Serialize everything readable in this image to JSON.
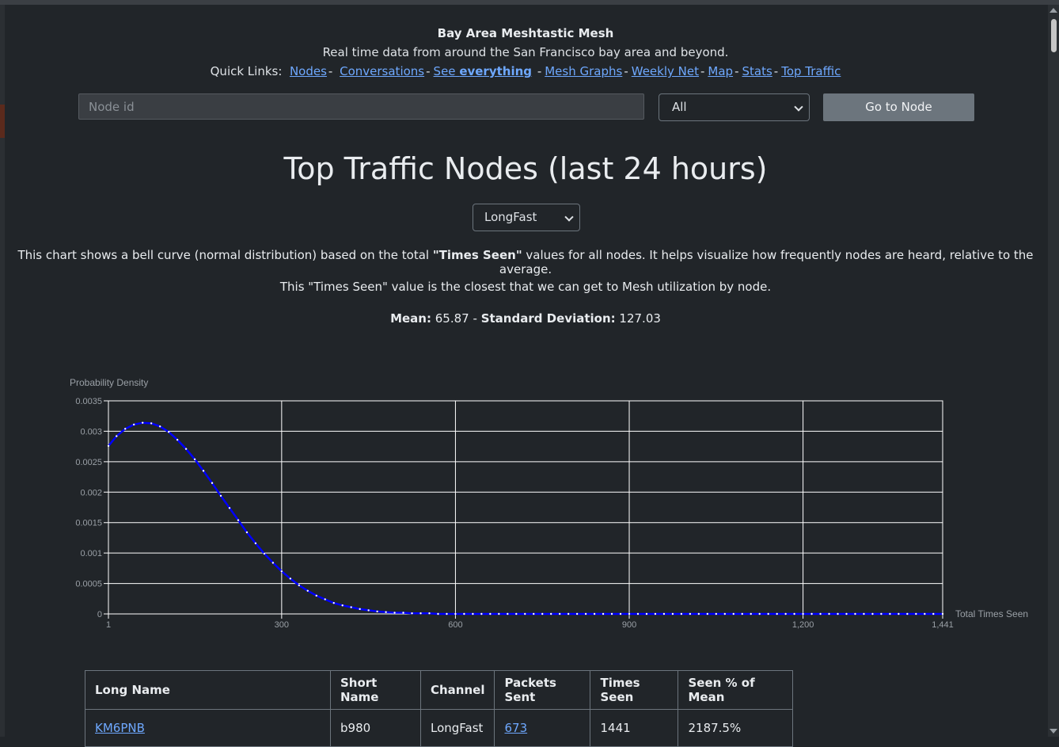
{
  "header": {
    "site_title": "Bay Area Meshtastic Mesh",
    "tagline": "Real time data from around the San Francisco bay area and beyond.",
    "quick_links_label": "Quick Links:",
    "links": {
      "nodes": "Nodes",
      "conversations": "Conversations",
      "see": "See",
      "everything": "everything",
      "mesh_graphs": "Mesh Graphs",
      "weekly_net": "Weekly Net",
      "map": "Map",
      "stats": "Stats",
      "top_traffic": "Top Traffic"
    },
    "separator": "-"
  },
  "search": {
    "placeholder": "Node id",
    "value": "",
    "filter_selected": "All",
    "go_button": "Go to Node"
  },
  "page": {
    "title": "Top Traffic Nodes (last 24 hours)",
    "channel_selected": "LongFast",
    "description_pre": "This chart shows a bell curve (normal distribution) based on the total ",
    "description_bold": "\"Times Seen\"",
    "description_post": " values for all nodes. It helps visualize how frequently nodes are heard, relative to the average.",
    "note": "This \"Times Seen\" value is the closest that we can get to Mesh utilization by node.",
    "mean_label": "Mean:",
    "mean_value": "65.87",
    "stats_sep": "-",
    "std_label": "Standard Deviation:",
    "std_value": "127.03"
  },
  "chart_data": {
    "type": "line",
    "title": "",
    "xlabel": "Total Times Seen",
    "ylabel": "Probability Density",
    "xlim": [
      1,
      1441
    ],
    "ylim": [
      0,
      0.0035
    ],
    "x_ticks": [
      1,
      300,
      600,
      900,
      1200,
      1441
    ],
    "x_tick_labels": [
      "1",
      "300",
      "600",
      "900",
      "1,200",
      "1,441"
    ],
    "y_ticks": [
      0,
      0.0005,
      0.001,
      0.0015,
      0.002,
      0.0025,
      0.003,
      0.0035
    ],
    "y_tick_labels": [
      "0",
      "0.0005",
      "0.001",
      "0.0015",
      "0.002",
      "0.0025",
      "0.003",
      "0.0035"
    ],
    "grid": true,
    "legend": "none",
    "series_color": "#0000ff",
    "distribution": {
      "mean": 65.87,
      "std": 127.03
    },
    "series": [
      {
        "x": [
          1,
          15,
          30,
          45,
          60,
          75,
          90,
          105,
          120,
          135,
          150,
          165,
          180,
          195,
          210,
          225,
          240,
          255,
          270,
          285,
          300,
          315,
          330,
          345,
          360,
          375,
          390,
          405,
          420,
          435,
          450,
          465,
          480,
          495,
          510,
          525,
          540,
          555,
          570,
          585,
          600,
          615,
          630,
          645,
          660,
          675,
          690,
          705,
          720,
          735,
          750,
          765,
          780,
          795,
          810,
          825,
          840,
          855,
          870,
          885,
          900,
          915,
          930,
          945,
          960,
          975,
          990,
          1005,
          1020,
          1035,
          1050,
          1065,
          1080,
          1095,
          1110,
          1125,
          1140,
          1155,
          1170,
          1185,
          1200,
          1215,
          1230,
          1245,
          1260,
          1275,
          1290,
          1305,
          1320,
          1335,
          1350,
          1365,
          1380,
          1395,
          1410,
          1425,
          1441
        ],
        "y": [
          0.00276,
          0.00292,
          0.00304,
          0.00311,
          0.00314,
          0.00313,
          0.00308,
          0.00299,
          0.00286,
          0.00271,
          0.00254,
          0.00235,
          0.00215,
          0.00194,
          0.00174,
          0.00154,
          0.00134,
          0.00116,
          0.00099,
          0.00084,
          0.0007,
          0.00058,
          0.00047,
          0.00038,
          0.0003,
          0.00024,
          0.00018,
          0.00014,
          0.00011,
          8e-05,
          6e-05,
          4e-05,
          3e-05,
          2e-05,
          2e-05,
          1e-05,
          1e-05,
          1e-05,
          0,
          0,
          0,
          0,
          0,
          0,
          0,
          0,
          0,
          0,
          0,
          0,
          0,
          0,
          0,
          0,
          0,
          0,
          0,
          0,
          0,
          0,
          0,
          0,
          0,
          0,
          0,
          0,
          0,
          0,
          0,
          0,
          0,
          0,
          0,
          0,
          0,
          0,
          0,
          0,
          0,
          0,
          0,
          0,
          0,
          0,
          0,
          0,
          0,
          0,
          0,
          0,
          0,
          0,
          0,
          0,
          0,
          0,
          0
        ]
      }
    ]
  },
  "table": {
    "headers": [
      "Long Name",
      "Short Name",
      "Channel",
      "Packets Sent",
      "Times Seen",
      "Seen % of Mean"
    ],
    "rows": [
      [
        "KM6PNB",
        "b980",
        "LongFast",
        "673",
        "1441",
        "2187.5%"
      ]
    ]
  }
}
